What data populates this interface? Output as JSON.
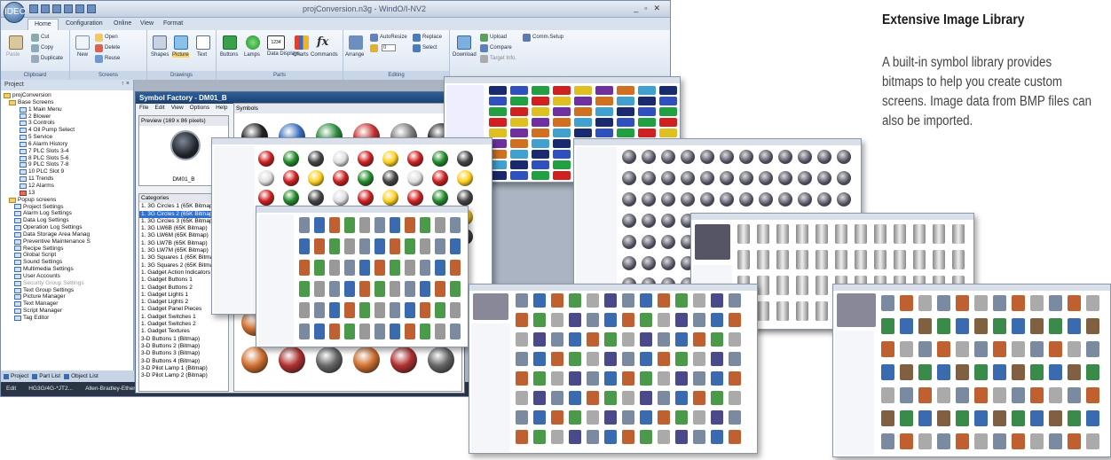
{
  "window": {
    "title": "projConversion.n3g - WindO/I-NV2",
    "orb_label": "IDEC"
  },
  "ribbon": {
    "tabs": [
      "Home",
      "Configuration",
      "Online",
      "View",
      "Format"
    ],
    "groups": {
      "clipboard": {
        "label": "Clipboard",
        "paste": "Paste",
        "cut": "Cut",
        "copy": "Copy",
        "duplicate": "Duplicate"
      },
      "screens": {
        "label": "Screens",
        "new": "New",
        "open": "Open",
        "delete": "Delete",
        "reuse": "Reuse"
      },
      "drawings": {
        "label": "Drawings",
        "shapes": "Shapes",
        "picture": "Picture",
        "text": "Text"
      },
      "parts": {
        "label": "Parts",
        "buttons": "Buttons",
        "lamps": "Lamps",
        "data_displays": "Data Displays",
        "charts": "Charts",
        "commands": "Commands",
        "data_icon": "1234"
      },
      "editing": {
        "label": "Editing",
        "arrange": "Arrange",
        "autoresize": "AutoResize",
        "replace": "Replace",
        "select": "Select",
        "value": "0"
      },
      "transfer": {
        "download": "Download",
        "upload": "Upload",
        "compare": "Compare",
        "target_info": "Target Info.",
        "comm_setup": "Comm.Setup"
      }
    }
  },
  "project_panel": {
    "title": "Project",
    "pin": "↑ ×",
    "root": "projConversion",
    "base_screens_label": "Base Screens",
    "base_screens": [
      "1 Main Menu",
      "2 Blower",
      "3 Controls",
      "4 Oil Pump Select",
      "5 Service",
      "6 Alarm History",
      "7 PLC Slots 3-4",
      "8 PLC Slots 5-6",
      "9 PLC Slots 7-8",
      "10 PLC Slot 9",
      "11 Trends",
      "12 Alarms",
      "13"
    ],
    "other_items": [
      "Popup screens",
      "Project Settings",
      "Alarm Log Settings",
      "Data Log Settings",
      "Operation Log Settings",
      "Data Storage Area Manag",
      "Preventive Maintenance S",
      "Recipe Settings",
      "Global Script",
      "Sound Settings",
      "Multimedia Settings",
      "User Accounts",
      "Security Group Settings",
      "Text Group Settings",
      "Picture Manager",
      "Text Manager",
      "Script Manager",
      "Tag Editor"
    ],
    "bottom_tabs": [
      "Project",
      "Part List",
      "Object List"
    ]
  },
  "statusbar": {
    "mode": "Edit",
    "model": "HG3G/4G-*JT2...",
    "plc": "Allen-Bradley-Ethernet/"
  },
  "symbol_factory": {
    "title": "Symbol Factory - DM01_B",
    "menu": [
      "File",
      "Edit",
      "View",
      "Options",
      "Help"
    ],
    "preview_header": "Preview (169 x 86 pixels)",
    "preview_name": "DM01_B",
    "categories_header": "Categories",
    "symbols_header": "Symbols",
    "categories": [
      "1. 3G Circles 1 (65K Bitmap)",
      "1. 3G Circles 2 (65K Bitmap)",
      "1. 3G Circles 3 (65K Bitmap)",
      "1. 3G LW6B (65K Bitmap)",
      "1. 3G LW6M (65K Bitmap)",
      "1. 3G LW7B (65K Bitmap)",
      "1. 3G LW7M (65K Bitmap)",
      "1. 3G Squares 1 (65K Bitmap)",
      "1. 3G Squares 2 (65K Bitmap)",
      "1. Gadget Action Indicators",
      "1. Gadget Buttons 1",
      "1. Gadget Buttons 2",
      "1. Gadget Lights 1",
      "1. Gadget Lights 2",
      "1. Gadget Panel Pieces",
      "1. Gadget Switches 1",
      "1. Gadget Switches 2",
      "1. Gadget Textures",
      "3-D Buttons 1 (Bitmap)",
      "3-D Buttons 2 (Bitmap)",
      "3-D Buttons 3 (Bitmap)",
      "3-D Buttons 4 (Bitmap)",
      "3-D Pilot Lamp 1 (Bitmap)",
      "3-D Pilot Lamp 2 (Bitmap)"
    ],
    "selected_category": 1
  },
  "heading": "Extensive Image Library",
  "description_lines": [
    "A built-in symbol library provides",
    "bitmaps to help you create custom",
    "screens. Image data from BMP files can",
    "also be imported."
  ]
}
